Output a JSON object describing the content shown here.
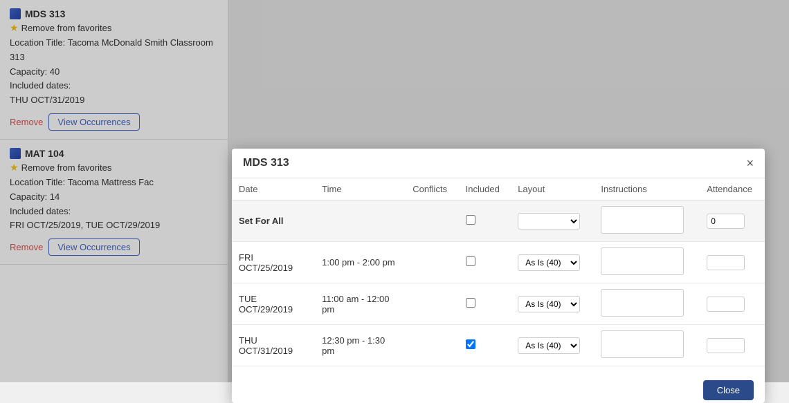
{
  "left_panel": {
    "cards": [
      {
        "id": "mds313",
        "title": "MDS 313",
        "favorite_label": "Remove from favorites",
        "location_label": "Location Title: Tacoma McDonald Smith Classroom 313",
        "capacity_label": "Capacity: 40",
        "included_dates_label": "Included dates:",
        "dates": "THU OCT/31/2019",
        "remove_label": "Remove",
        "view_occurrences_label": "View Occurrences"
      },
      {
        "id": "mat104",
        "title": "MAT 104",
        "favorite_label": "Remove from favorites",
        "location_label": "Location Title: Tacoma Mattress Fac",
        "capacity_label": "Capacity: 14",
        "included_dates_label": "Included dates:",
        "dates": "FRI OCT/25/2019, TUE OCT/29/2019",
        "remove_label": "Remove",
        "view_occurrences_label": "View Occurrences"
      }
    ]
  },
  "modal": {
    "title": "MDS 313",
    "close_label": "×",
    "columns": {
      "date": "Date",
      "time": "Time",
      "conflicts": "Conflicts",
      "included": "Included",
      "layout": "Layout",
      "instructions": "Instructions",
      "attendance": "Attendance"
    },
    "set_for_all": {
      "label": "Set For All",
      "attendance_value": "0"
    },
    "rows": [
      {
        "date": "FRI OCT/25/2019",
        "time": "1:00 pm - 2:00 pm",
        "conflicts": false,
        "included": false,
        "layout": "As Is (40)",
        "instructions": "",
        "attendance": ""
      },
      {
        "date": "TUE OCT/29/2019",
        "time": "11:00 am - 12:00 pm",
        "conflicts": false,
        "included": false,
        "layout": "As Is (40)",
        "instructions": "",
        "attendance": ""
      },
      {
        "date": "THU OCT/31/2019",
        "time": "12:30 pm - 1:30 pm",
        "conflicts": false,
        "included": true,
        "layout": "As Is (40)",
        "instructions": "",
        "attendance": ""
      }
    ],
    "close_button_label": "Close"
  }
}
